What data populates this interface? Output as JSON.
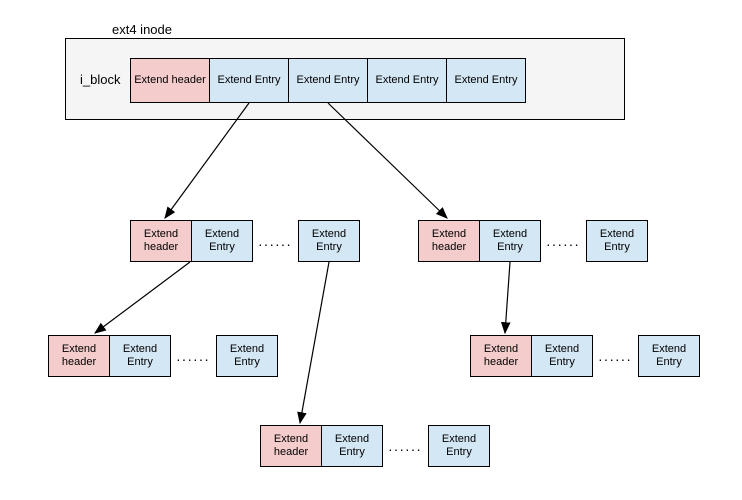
{
  "labels": {
    "container_title": "ext4 inode",
    "iblock": "i_block",
    "header": "Extend header",
    "entry": "Extend Entry",
    "ellipsis": "······"
  },
  "diagram": {
    "description": "ext4 inode extent tree. i_block holds one Extend header followed by four Extend Entries. Entries point to lower-level extent blocks, each beginning with an Extend header followed by Extend Entries, forming a multi-level tree.",
    "root": {
      "header": 1,
      "entries": 4
    },
    "level1_groups": 2,
    "level2_groups": 3
  }
}
